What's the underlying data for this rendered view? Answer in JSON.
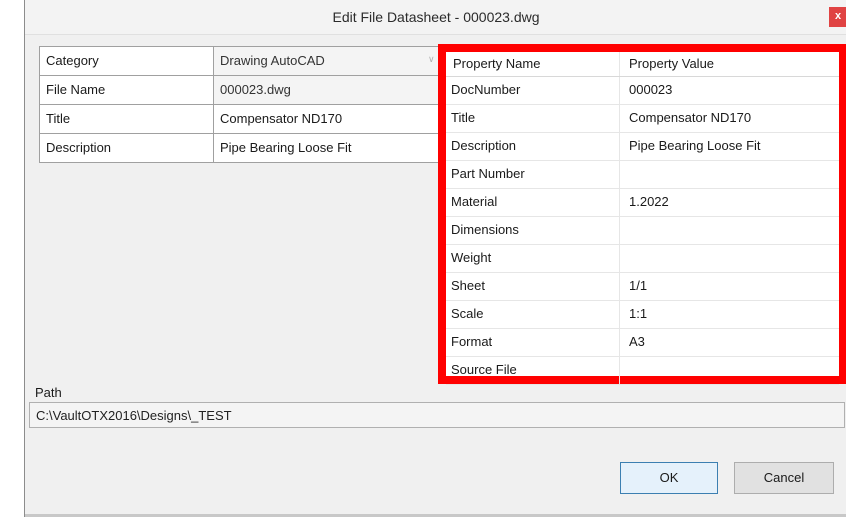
{
  "window": {
    "title": "Edit File Datasheet - 000023.dwg",
    "close_label": "x"
  },
  "left_grid": {
    "rows": [
      {
        "key": "Category",
        "value": "Drawing AutoCAD",
        "dropdown": true
      },
      {
        "key": "File Name",
        "value": "000023.dwg"
      },
      {
        "key": "Title",
        "value": "Compensator ND170"
      },
      {
        "key": "Description",
        "value": "Pipe Bearing Loose Fit"
      }
    ]
  },
  "properties": {
    "header": {
      "name": "Property Name",
      "value": "Property Value"
    },
    "rows": [
      {
        "name": "DocNumber",
        "value": "000023"
      },
      {
        "name": "Title",
        "value": "Compensator ND170"
      },
      {
        "name": "Description",
        "value": "Pipe Bearing Loose Fit"
      },
      {
        "name": "Part Number",
        "value": ""
      },
      {
        "name": "Material",
        "value": "1.2022"
      },
      {
        "name": "Dimensions",
        "value": ""
      },
      {
        "name": "Weight",
        "value": ""
      },
      {
        "name": "Sheet",
        "value": "1/1"
      },
      {
        "name": "Scale",
        "value": "1:1"
      },
      {
        "name": "Format",
        "value": "A3"
      },
      {
        "name": "Source File",
        "value": ""
      }
    ],
    "highlight_color": "#ff0000"
  },
  "path": {
    "label": "Path",
    "value": "C:\\VaultOTX2016\\Designs\\_TEST"
  },
  "buttons": {
    "ok": "OK",
    "cancel": "Cancel"
  }
}
